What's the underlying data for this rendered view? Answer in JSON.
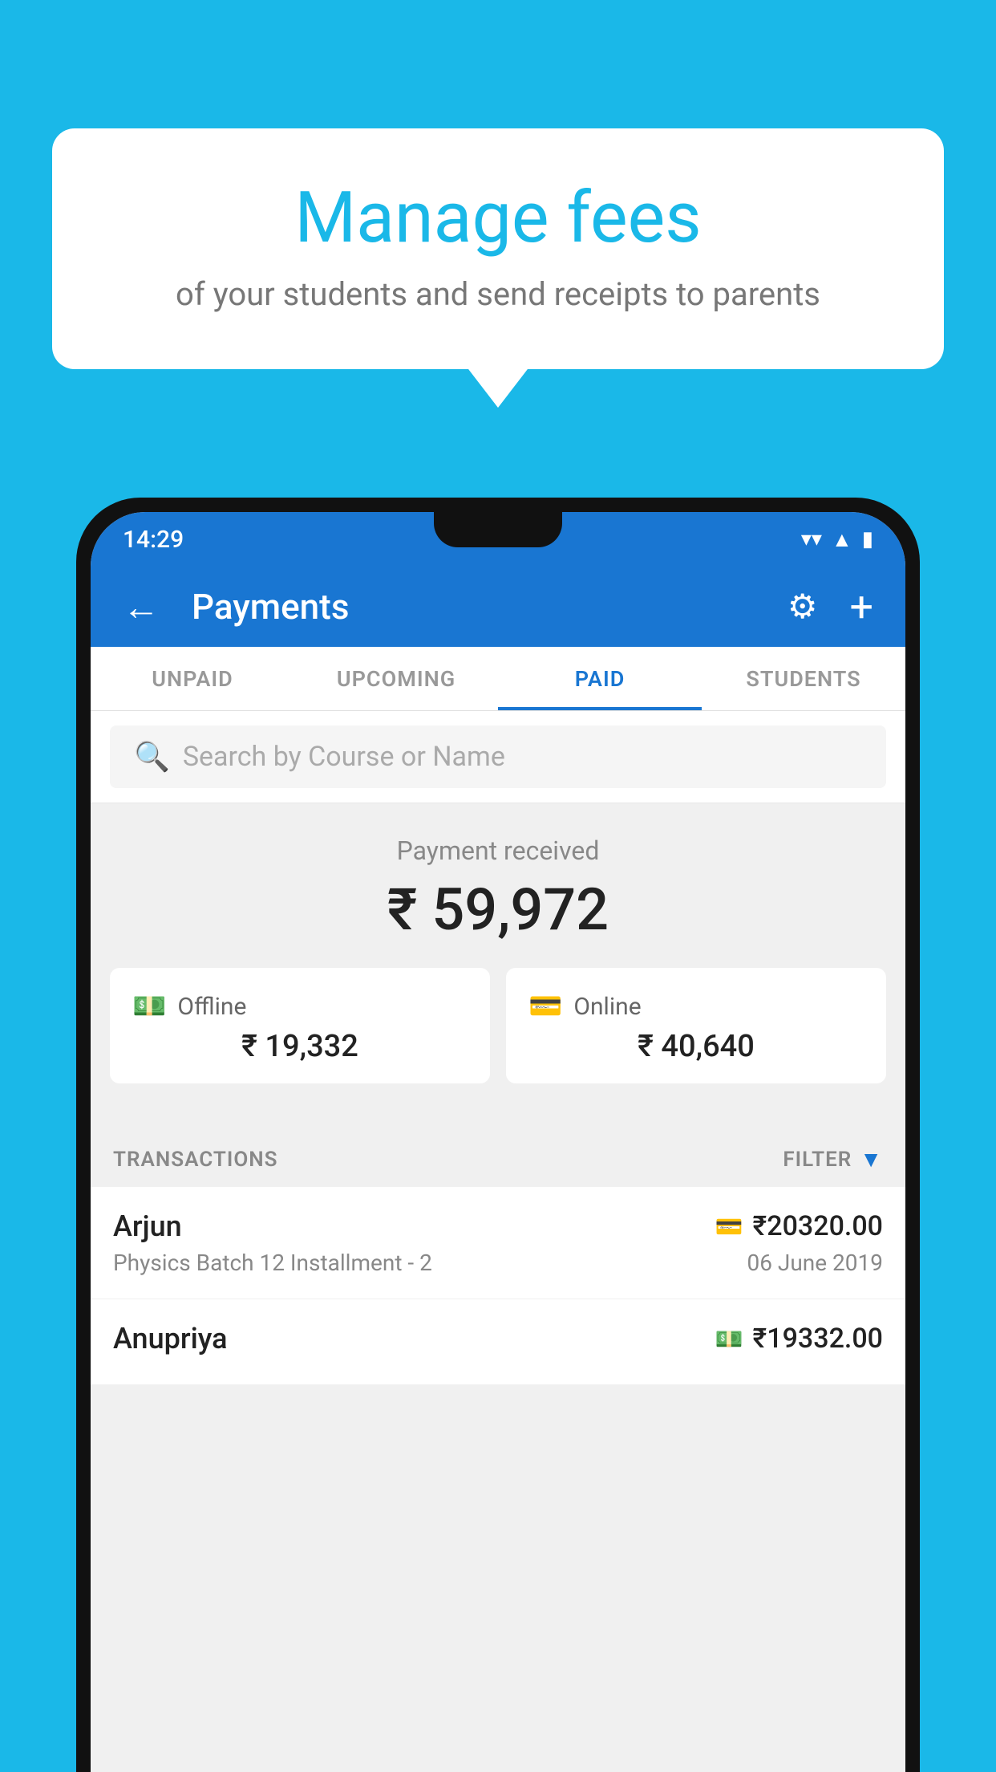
{
  "background_color": "#1ab8e8",
  "bubble": {
    "title": "Manage fees",
    "subtitle": "of your students and send receipts to parents"
  },
  "status_bar": {
    "time": "14:29",
    "wifi": "▼",
    "signal": "▲",
    "battery": "▌"
  },
  "app_bar": {
    "title": "Payments",
    "back_label": "←",
    "gear_label": "⚙",
    "plus_label": "+"
  },
  "tabs": [
    {
      "label": "UNPAID",
      "active": false
    },
    {
      "label": "UPCOMING",
      "active": false
    },
    {
      "label": "PAID",
      "active": true
    },
    {
      "label": "STUDENTS",
      "active": false
    }
  ],
  "search": {
    "placeholder": "Search by Course or Name"
  },
  "payment": {
    "label": "Payment received",
    "amount": "₹ 59,972",
    "offline": {
      "label": "Offline",
      "amount": "₹ 19,332"
    },
    "online": {
      "label": "Online",
      "amount": "₹ 40,640"
    }
  },
  "transactions": {
    "section_label": "TRANSACTIONS",
    "filter_label": "FILTER",
    "rows": [
      {
        "name": "Arjun",
        "course": "Physics Batch 12 Installment - 2",
        "amount": "₹20320.00",
        "date": "06 June 2019",
        "icon": "card"
      },
      {
        "name": "Anupriya",
        "course": "",
        "amount": "₹19332.00",
        "date": "",
        "icon": "cash"
      }
    ]
  }
}
